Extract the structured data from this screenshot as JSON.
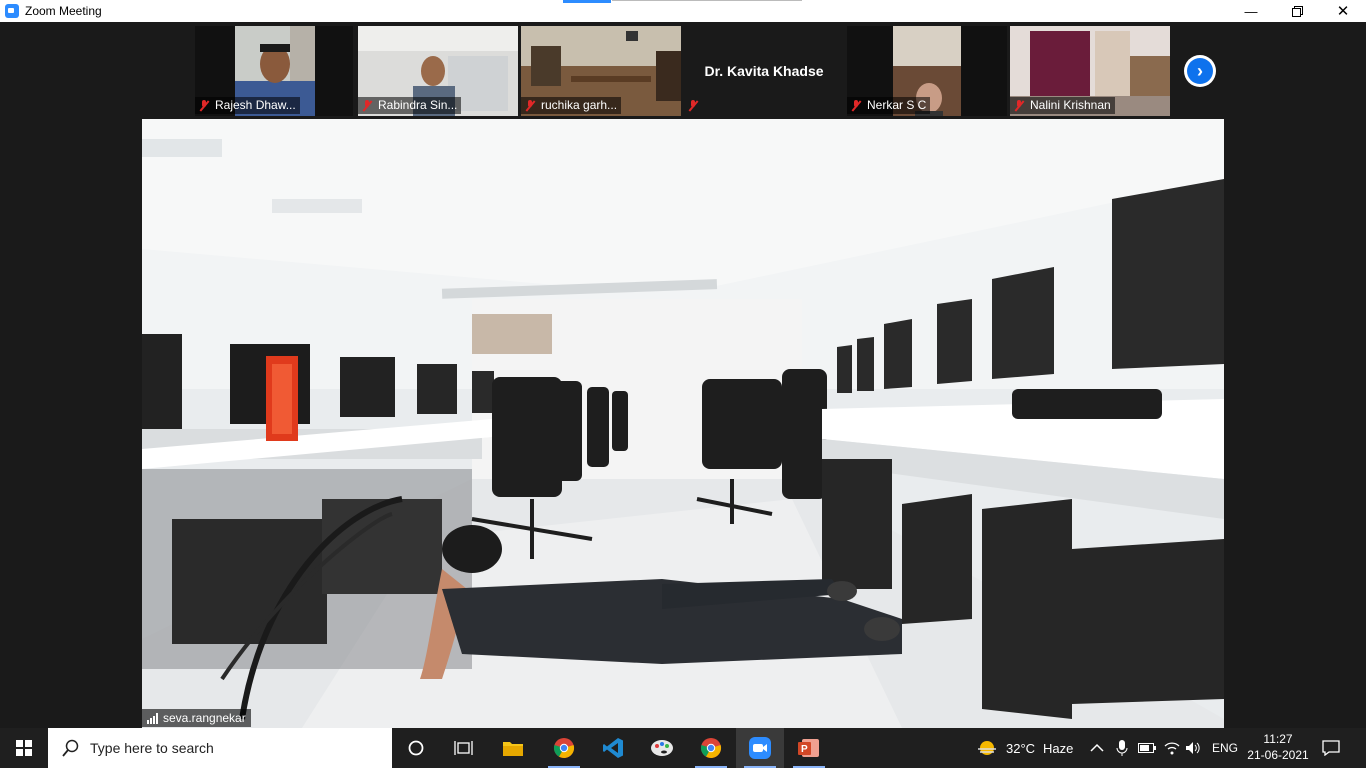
{
  "window": {
    "title": "Zoom Meeting"
  },
  "participants": [
    {
      "name": "Rajesh Dhaw...",
      "muted": true
    },
    {
      "name": "Rabindra Sin...",
      "muted": true
    },
    {
      "name": "ruchika garh...",
      "muted": true
    },
    {
      "name": "Dr. Kavita Khadse",
      "muted": true
    },
    {
      "name": "Nerkar S C",
      "muted": true
    },
    {
      "name": "Nalini Krishnan",
      "muted": true
    }
  ],
  "active_speaker": {
    "name": "seva.rangnekar"
  },
  "taskbar": {
    "search_placeholder": "Type here to search",
    "weather_temp": "32°C",
    "weather_desc": "Haze",
    "language": "ENG",
    "time": "11:27",
    "date": "21-06-2021",
    "apps": [
      "task-view",
      "file-explorer",
      "chrome",
      "vscode",
      "paint",
      "chrome",
      "zoom",
      "powerpoint"
    ]
  },
  "colors": {
    "accent": "#2d8cff",
    "muted_mic": "#e02828",
    "taskbar_bg": "#1f1f1f"
  }
}
